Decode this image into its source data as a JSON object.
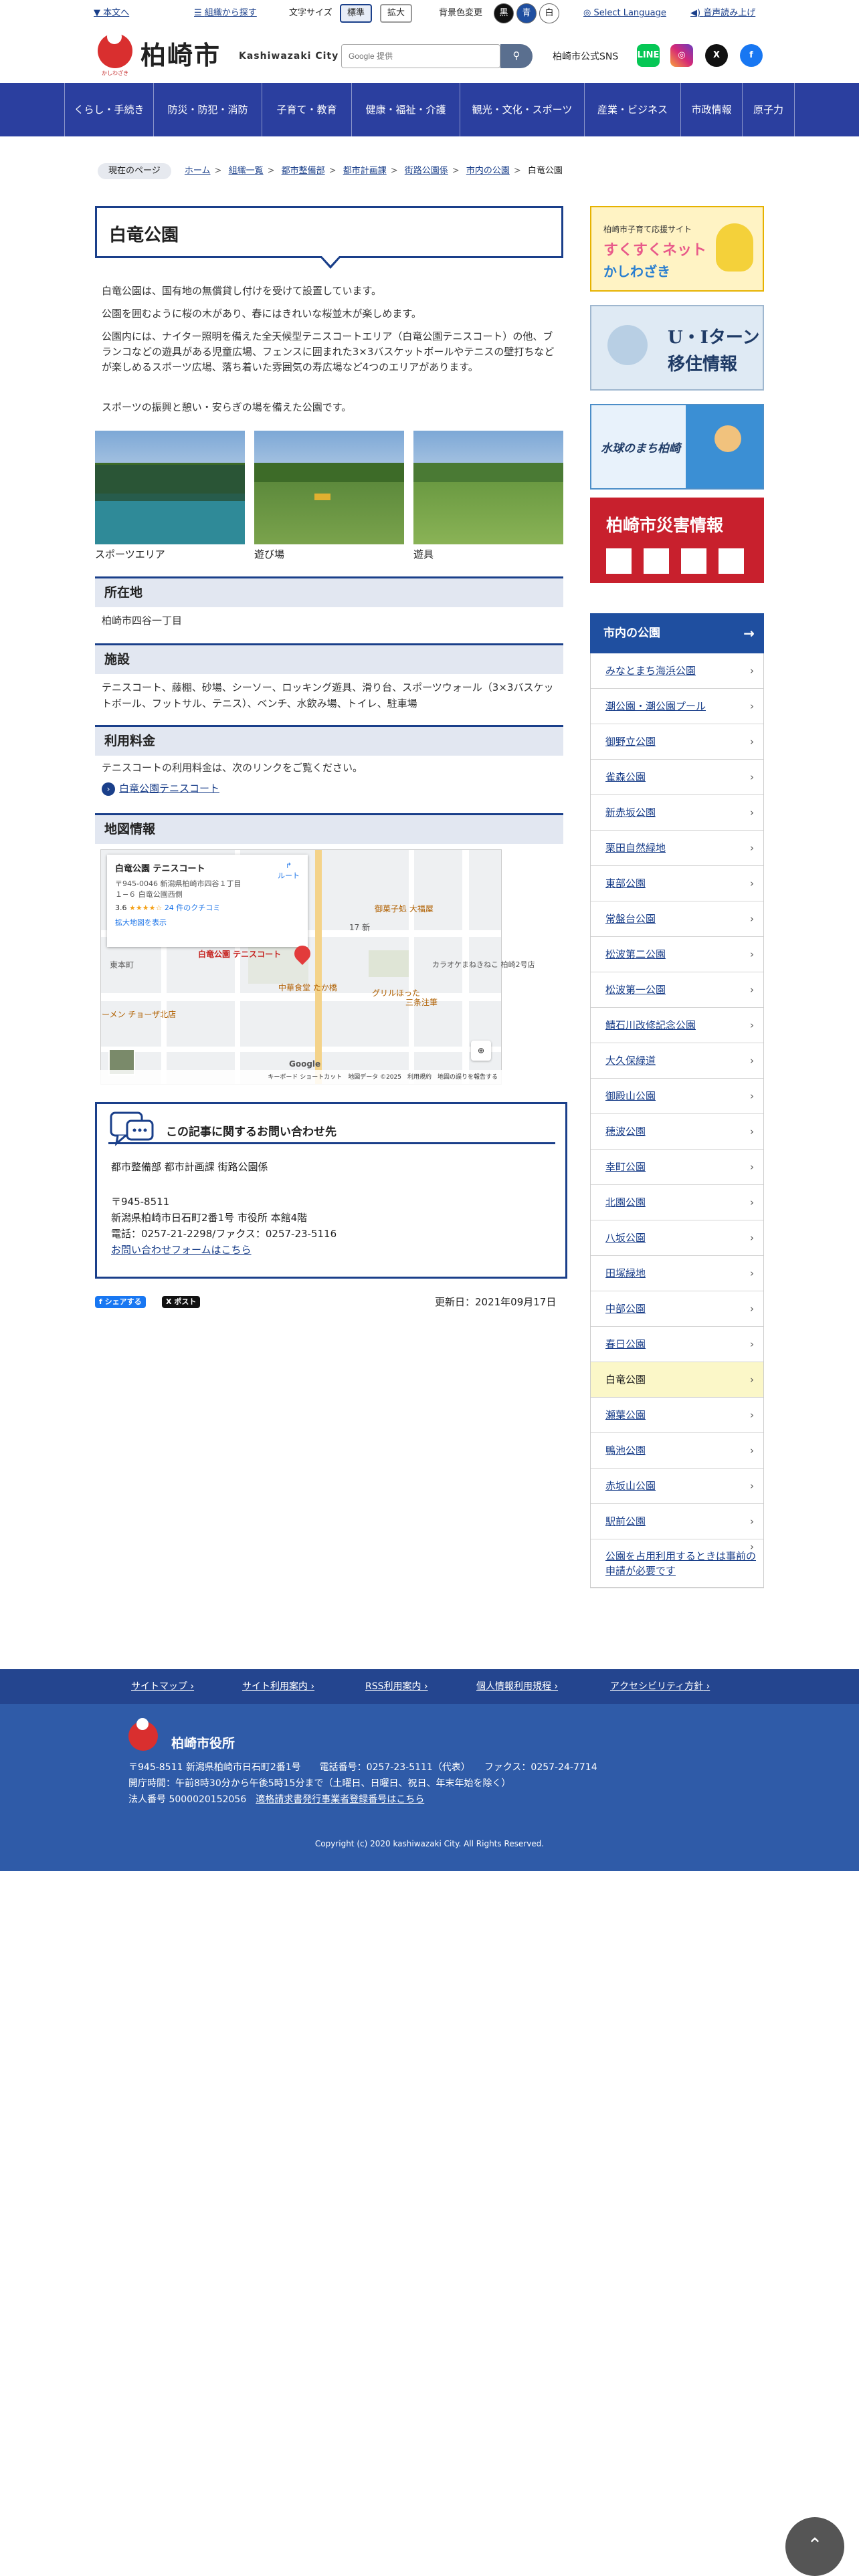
{
  "utility": {
    "skip": "本文へ",
    "org_search": "組織から探す",
    "font_size_label": "文字サイズ",
    "font_standard": "標準",
    "font_large": "拡大",
    "bg_color_label": "背景色変更",
    "bg_black": "黒",
    "bg_blue": "青",
    "bg_white": "白",
    "language": "Select Language",
    "speech": "音声読み上げ"
  },
  "header": {
    "city_name": "柏崎市",
    "city_en": "Kashiwazaki City",
    "logo_sub": "かしわざき",
    "search_placeholder": "Google 提供",
    "search_icon": "search-icon",
    "sns_label": "柏崎市公式SNS",
    "sns": [
      "LINE",
      "Instagram",
      "X",
      "Facebook"
    ]
  },
  "gnav": [
    "くらし・手続き",
    "防災・防犯・消防",
    "子育て・教育",
    "健康・福祉・介護",
    "観光・文化・スポーツ",
    "産業・ビジネス",
    "市政情報",
    "原子力"
  ],
  "breadcrumb": {
    "here": "現在のページ",
    "items": [
      "ホーム",
      "組織一覧",
      "都市整備部",
      "都市計画課",
      "街路公園係",
      "市内の公園"
    ],
    "current": "白竜公園"
  },
  "page": {
    "title": "白竜公園",
    "paragraphs": [
      "白竜公園は、国有地の無償貸し付けを受けて設置しています。",
      "公園を囲むように桜の木があり、春にはきれいな桜並木が楽しめます。",
      "公園内には、ナイター照明を備えた全天候型テニスコートエリア（白竜公園テニスコート）の他、ブランコなどの遊具がある児童広場、フェンスに囲まれた3×3バスケットボールやテニスの壁打ちなどが楽しめるスポーツ広場、落ち着いた雰囲気の寿広場など4つのエリアがあります。",
      "スポーツの振興と憩い・安らぎの場を備えた公園です。"
    ],
    "photos": [
      {
        "caption": "スポーツエリア"
      },
      {
        "caption": "遊び場"
      },
      {
        "caption": "遊具"
      }
    ],
    "location_h": "所在地",
    "location": "柏崎市四谷一丁目",
    "facility_h": "施設",
    "facility": "テニスコート、藤棚、砂場、シーソー、ロッキング遊具、滑り台、スポーツウォール（3×3バスケットボール、フットサル、テニス）、ベンチ、水飲み場、トイレ、駐車場",
    "fee_h": "利用料金",
    "fee": "テニスコートの利用料金は、次のリンクをご覧ください。",
    "fee_link": "白竜公園テニスコート",
    "map_h": "地図情報"
  },
  "map": {
    "card_title": "白竜公園 テニスコート",
    "card_addr1": "〒945-0046 新潟県柏崎市四谷１丁目",
    "card_addr2": "１−６ 白竜公園西側",
    "rating": "3.6",
    "stars": "★★★★☆",
    "reviews": "24 件のクチコミ",
    "enlarge": "拡大地図を表示",
    "route": "ルート",
    "pin_label": "白竜公園 テニスコート",
    "labels": [
      "御菓子処 大福屋",
      "中華食堂 たか橋",
      "グリルほった",
      "三条注筆",
      "カラオケまねきねこ 柏崎2号店",
      "東本町",
      "ーメン チョーザ北店",
      "17 新"
    ],
    "footer": "キーボード ショートカット　地図データ ©2025　利用規約　地図の誤りを報告する",
    "google": "Google"
  },
  "contact": {
    "title": "この記事に関するお問い合わせ先",
    "dept": "都市整備部 都市計画課 街路公園係",
    "zip": "〒945-8511",
    "address": "新潟県柏崎市日石町2番1号 市役所 本館4階",
    "phone": "電話：0257-21-2298/ファクス：0257-23-5116",
    "form": "お問い合わせフォームはこちら"
  },
  "share": {
    "fb": "シェアする",
    "x": "ポスト"
  },
  "updated": "更新日：2021年09月17日",
  "banners": [
    {
      "line1": "柏崎市子育て応援サイト",
      "line2": "すくすくネット",
      "line3": "かしわざき"
    },
    {
      "line1": "U・Iターン",
      "line2": "移住情報"
    },
    {
      "line1": "水球のまち柏崎"
    },
    {
      "line1": "柏崎市災害情報"
    }
  ],
  "side": {
    "heading": "市内の公園",
    "items": [
      "みなとまち海浜公園",
      "潮公園・潮公園プール",
      "御野立公園",
      "雀森公園",
      "新赤坂公園",
      "栗田自然緑地",
      "東部公園",
      "常盤台公園",
      "松波第二公園",
      "松波第一公園",
      "鯖石川改修記念公園",
      "大久保緑道",
      "御殿山公園",
      "穂波公園",
      "幸町公園",
      "北園公園",
      "八坂公園",
      "田塚緑地",
      "中部公園",
      "春日公園",
      "白竜公園",
      "瀬葉公園",
      "鴨池公園",
      "赤坂山公園",
      "駅前公園"
    ],
    "last": "公園を占用利用するときは事前の申請が必要です",
    "current_index": 20
  },
  "footer": {
    "nav": [
      "サイトマップ",
      "サイト利用案内",
      "RSS利用案内",
      "個人情報利用規程",
      "アクセシビリティ方針"
    ],
    "name": "柏崎市役所",
    "line1": "〒945-8511 新潟県柏崎市日石町2番1号　　電話番号：0257-23-5111（代表）　　ファクス：0257-24-7714",
    "line2": "開庁時間：午前8時30分から午後5時15分まで（土曜日、日曜日、祝日、年末年始を除く）",
    "line3_a": "法人番号 5000020152056",
    "line3_b": "適格請求書発行事業者登録番号はこちら",
    "copyright": "Copyright (c) 2020 kashiwazaki City. All Rights Reserved."
  }
}
